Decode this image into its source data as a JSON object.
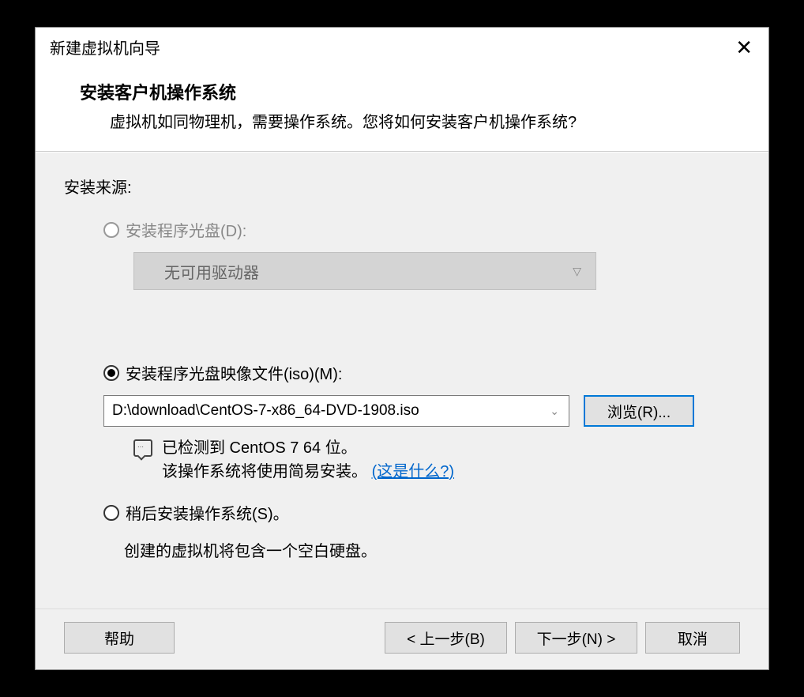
{
  "titlebar": {
    "title": "新建虚拟机向导"
  },
  "header": {
    "title": "安装客户机操作系统",
    "description": "虚拟机如同物理机，需要操作系统。您将如何安装客户机操作系统?"
  },
  "content": {
    "source_label": "安装来源:",
    "option_disc": {
      "label": "安装程序光盘(D):",
      "dropdown_value": "无可用驱动器"
    },
    "option_iso": {
      "label": "安装程序光盘映像文件(iso)(M):",
      "path": "D:\\download\\CentOS-7-x86_64-DVD-1908.iso",
      "browse_label": "浏览(R)..."
    },
    "info": {
      "line1": "已检测到 CentOS 7 64 位。",
      "line2_prefix": "该操作系统将使用简易安装。",
      "line2_link": "(这是什么?)"
    },
    "option_later": {
      "label": "稍后安装操作系统(S)。",
      "description": "创建的虚拟机将包含一个空白硬盘。"
    }
  },
  "footer": {
    "help": "帮助",
    "back": "< 上一步(B)",
    "next": "下一步(N) >",
    "cancel": "取消"
  }
}
